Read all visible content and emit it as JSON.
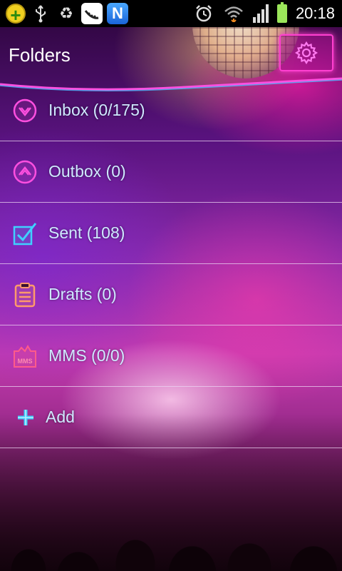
{
  "status_bar": {
    "time": "20:18",
    "notification_icons": [
      "plus-badge-icon",
      "usb-icon",
      "recycle-icon",
      "app-icon",
      "n-app-icon"
    ],
    "system_icons": [
      "alarm-icon",
      "wifi-icon",
      "signal-icon",
      "battery-charging-icon"
    ],
    "n_badge_letter": "N"
  },
  "header": {
    "title": "Folders"
  },
  "folders": [
    {
      "label": "Inbox (0/175)",
      "icon": "inbox-icon"
    },
    {
      "label": "Outbox (0)",
      "icon": "outbox-icon"
    },
    {
      "label": "Sent (108)",
      "icon": "sent-icon"
    },
    {
      "label": "Drafts (0)",
      "icon": "drafts-icon"
    },
    {
      "label": "MMS (0/0)",
      "icon": "mms-icon",
      "icon_text": "MMS"
    }
  ],
  "add": {
    "label": "Add",
    "icon": "add-icon"
  },
  "colors": {
    "accent_pink": "#ff3fd0",
    "accent_cyan": "#3fd0ff",
    "label_text": "#cfe9ff",
    "divider": "#ebd2f0"
  }
}
